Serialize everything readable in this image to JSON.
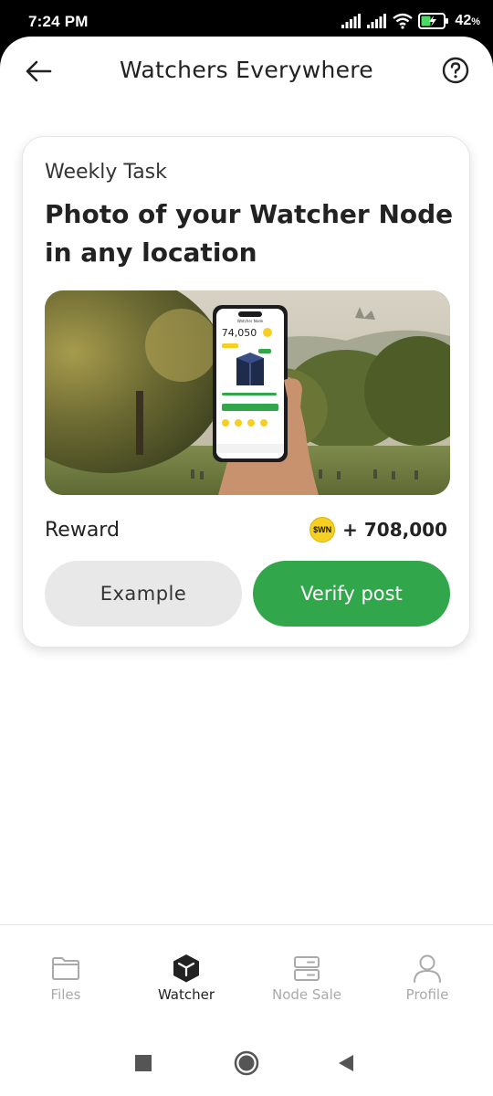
{
  "status_bar": {
    "time": "7:24 PM",
    "battery_percent": "42",
    "battery_unit": "%"
  },
  "header": {
    "title": "Watchers Everywhere",
    "back_icon": "arrow-left-icon",
    "help_icon": "question-circle-icon"
  },
  "task_card": {
    "label": "Weekly Task",
    "title": "Photo of your Watcher Node in any location",
    "image_phone_number": "74,050",
    "reward_label": "Reward",
    "reward_coin": "$WN",
    "reward_amount": "+ 708,000",
    "example_button": "Example",
    "verify_button": "Verify post"
  },
  "bottom_nav": {
    "items": [
      {
        "label": "Files",
        "icon": "folder-icon",
        "active": false
      },
      {
        "label": "Watcher",
        "icon": "cube-icon",
        "active": true
      },
      {
        "label": "Node Sale",
        "icon": "server-icon",
        "active": false
      },
      {
        "label": "Profile",
        "icon": "user-icon",
        "active": false
      }
    ]
  },
  "colors": {
    "accent_green": "#31a64a",
    "coin_yellow": "#f5cf22",
    "inactive_nav": "#aaaaaa"
  }
}
